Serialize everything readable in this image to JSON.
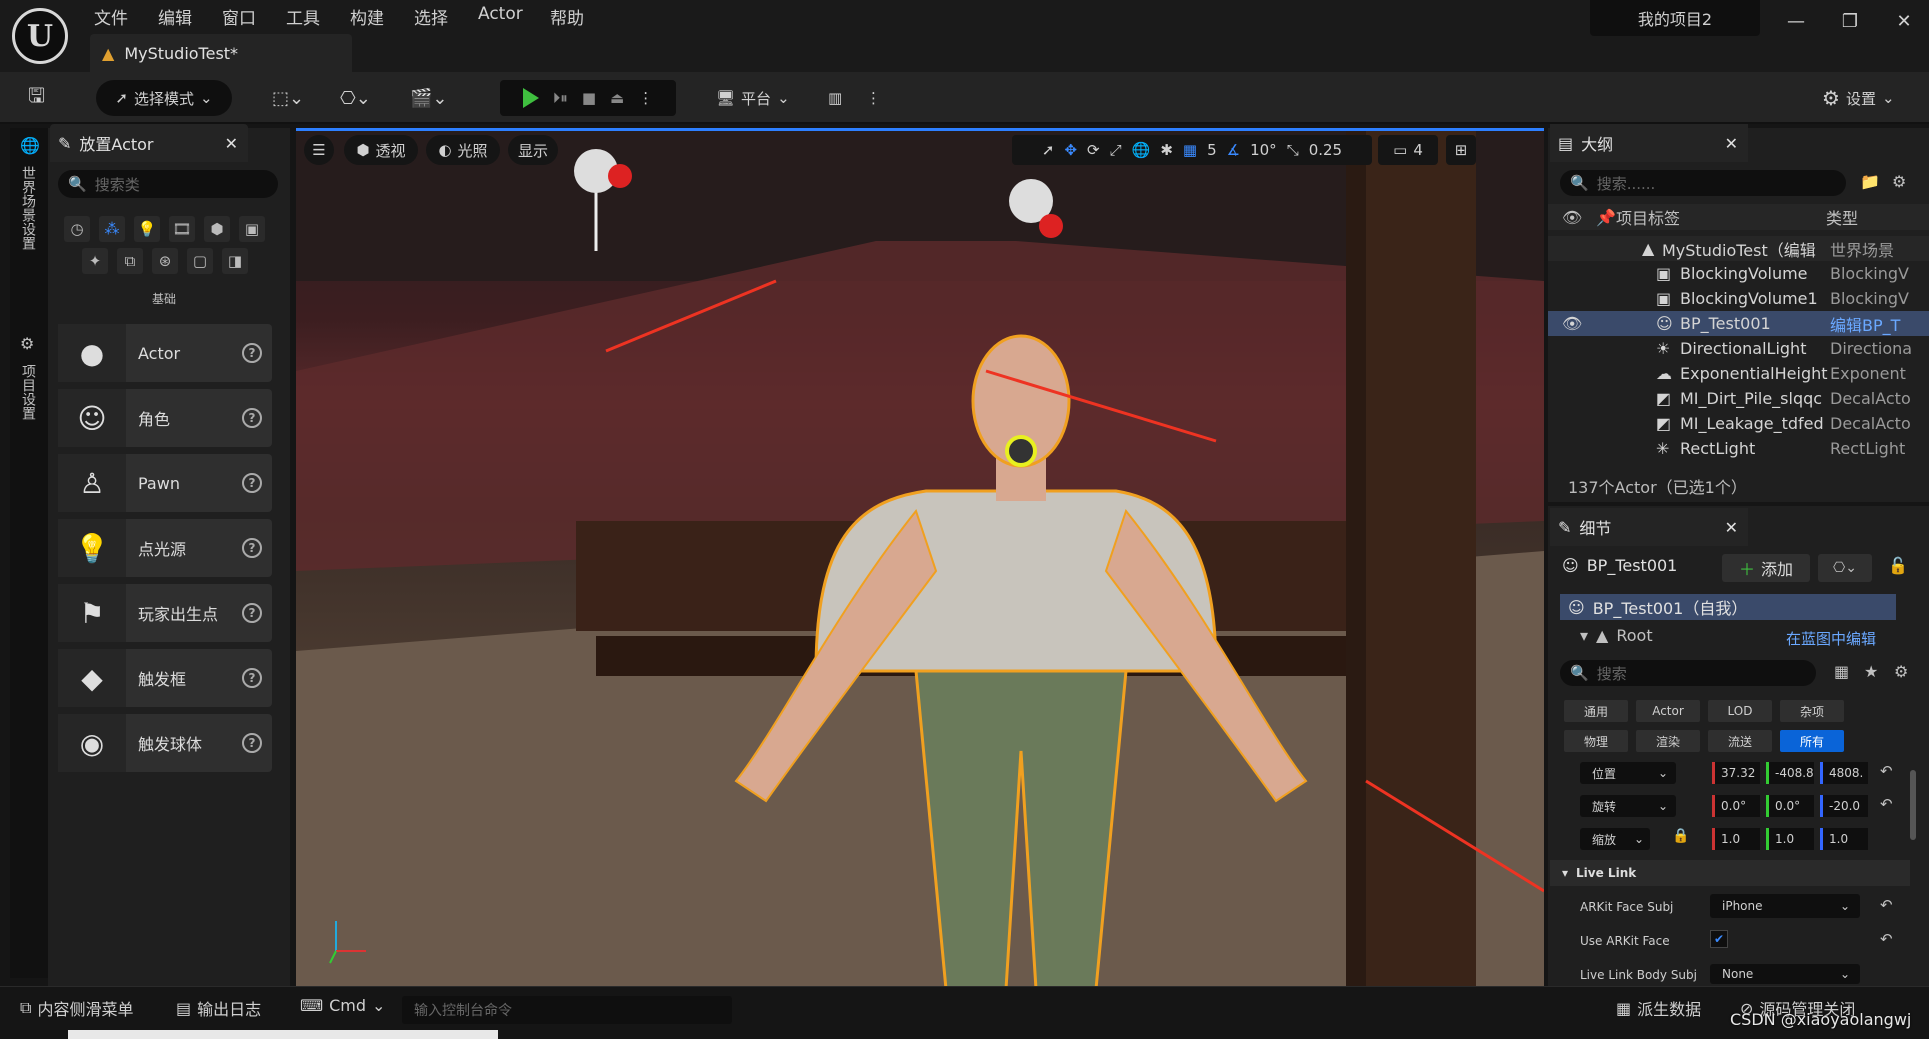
{
  "menu": [
    "文件",
    "编辑",
    "窗口",
    "工具",
    "构建",
    "选择",
    "Actor",
    "帮助"
  ],
  "document_tab": "MyStudioTest*",
  "project_name": "我的项目2",
  "toolbar": {
    "select_mode": "选择模式",
    "platform": "平台",
    "settings": "设置"
  },
  "side_tabs": [
    "世界场景设置",
    "项目设置"
  ],
  "place_actors": {
    "title": "放置Actor",
    "search_placeholder": "搜索类",
    "category_label": "基础",
    "items": [
      {
        "label": "Actor",
        "icon": "sphere-icon"
      },
      {
        "label": "角色",
        "icon": "character-icon"
      },
      {
        "label": "Pawn",
        "icon": "pawn-icon"
      },
      {
        "label": "点光源",
        "icon": "point-light-icon"
      },
      {
        "label": "玩家出生点",
        "icon": "player-start-icon"
      },
      {
        "label": "触发框",
        "icon": "trigger-box-icon"
      },
      {
        "label": "触发球体",
        "icon": "trigger-sphere-icon"
      }
    ]
  },
  "viewport": {
    "perspective": "透视",
    "lighting": "光照",
    "show": "显示",
    "grid_snap": "5",
    "rotation_snap": "10°",
    "scale_snap": "0.25",
    "camera_speed": "4"
  },
  "outliner": {
    "title": "大纲",
    "search_placeholder": "搜索......",
    "col_label": "项目标签",
    "col_type": "类型",
    "rows": [
      {
        "name": "MyStudioTest（编辑",
        "type": "世界场景"
      },
      {
        "name": "BlockingVolume",
        "type": "BlockingV"
      },
      {
        "name": "BlockingVolume1",
        "type": "BlockingV"
      },
      {
        "name": "BP_Test001",
        "type": "编辑BP_T"
      },
      {
        "name": "DirectionalLight",
        "type": "Directiona"
      },
      {
        "name": "ExponentialHeight",
        "type": "Exponent"
      },
      {
        "name": "MI_Dirt_Pile_slqqc",
        "type": "DecalActo"
      },
      {
        "name": "MI_Leakage_tdfed",
        "type": "DecalActo"
      },
      {
        "name": "RectLight",
        "type": "RectLight"
      }
    ],
    "count": "137个Actor（已选1个）"
  },
  "details": {
    "title": "细节",
    "actor_name": "BP_Test001",
    "add": "添加",
    "self_row": "BP_Test001（自我）",
    "root": "Root",
    "edit_in_bp": "在蓝图中编辑",
    "search_placeholder": "搜索",
    "filters": [
      "通用",
      "Actor",
      "LOD",
      "杂项",
      "物理",
      "渲染",
      "流送",
      "所有"
    ],
    "location_label": "位置",
    "location": [
      "37.32",
      "-408.8",
      "4808."
    ],
    "rotation_label": "旋转",
    "rotation": [
      "0.0°",
      "0.0°",
      "-20.0"
    ],
    "scale_label": "缩放",
    "scale": [
      "1.0",
      "1.0",
      "1.0"
    ],
    "section": "Live Link",
    "arkit_label": "ARKit Face Subj",
    "arkit_value": "iPhone",
    "use_arkit_label": "Use ARKit Face",
    "body_label": "Live Link Body Subj",
    "body_value": "None"
  },
  "bottom": {
    "content_drawer": "内容侧滑菜单",
    "output_log": "输出日志",
    "cmd": "Cmd",
    "console_placeholder": "输入控制台命令",
    "derived_data": "派生数据",
    "source_control": "源码管理关闭",
    "watermark": "CSDN @xiaoyaolangwj"
  }
}
